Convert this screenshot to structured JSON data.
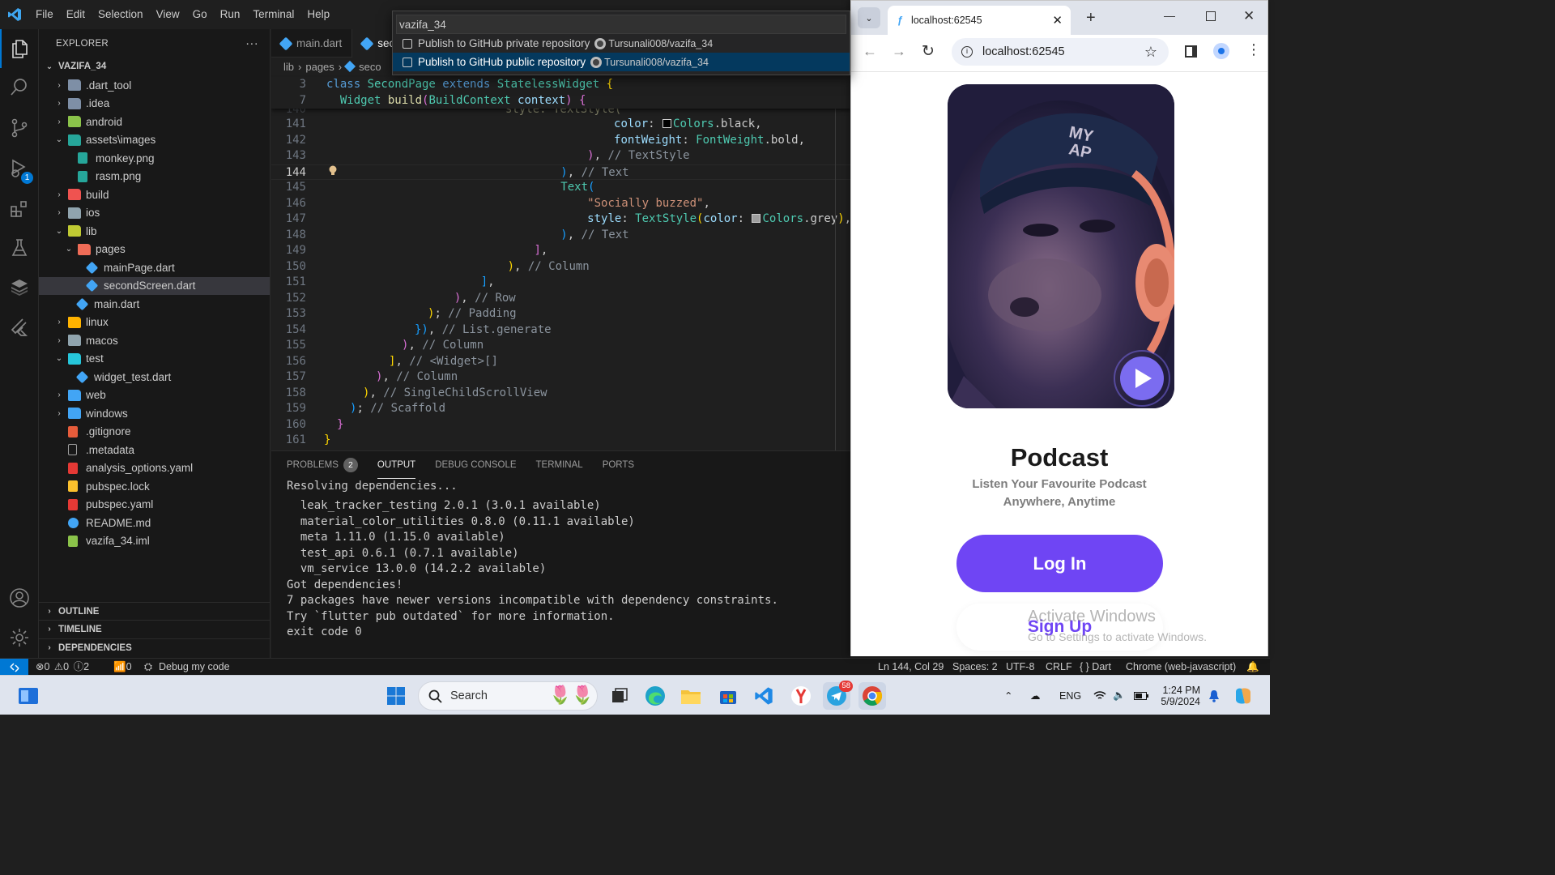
{
  "menu": [
    "File",
    "Edit",
    "Selection",
    "View",
    "Go",
    "Run",
    "Terminal",
    "Help"
  ],
  "palette": {
    "query": "vazifa_34",
    "items": [
      {
        "label": "Publish to GitHub private repository",
        "repo": "Tursunali008/vazifa_34",
        "selected": false
      },
      {
        "label": "Publish to GitHub public repository",
        "repo": "Tursunali008/vazifa_34",
        "selected": true
      }
    ]
  },
  "activity": {
    "icons": [
      "explorer-icon",
      "search-icon",
      "source-control-icon",
      "run-debug-icon",
      "extensions-icon",
      "testing-icon",
      "stack-icon",
      "flutter-icon",
      "account-icon",
      "settings-gear-icon"
    ],
    "debug_badge": "1"
  },
  "sidebar": {
    "title": "EXPLORER",
    "more": "···",
    "project": "VAZIFA_34",
    "tree": [
      {
        "label": ".dart_tool",
        "indent": 0,
        "chev": "›",
        "icon": "folder",
        "color": "#7e8fa6"
      },
      {
        "label": ".idea",
        "indent": 0,
        "chev": "›",
        "icon": "folder",
        "color": "#7e8fa6"
      },
      {
        "label": "android",
        "indent": 0,
        "chev": "›",
        "icon": "folder",
        "color": "#8bc34a"
      },
      {
        "label": "assets\\images",
        "indent": 0,
        "chev": "⌄",
        "icon": "folder",
        "color": "#26a69a"
      },
      {
        "label": "monkey.png",
        "indent": 1,
        "chev": "",
        "icon": "image",
        "color": "#26a69a"
      },
      {
        "label": "rasm.png",
        "indent": 1,
        "chev": "",
        "icon": "image",
        "color": "#26a69a"
      },
      {
        "label": "build",
        "indent": 0,
        "chev": "›",
        "icon": "folder",
        "color": "#ef5350"
      },
      {
        "label": "ios",
        "indent": 0,
        "chev": "›",
        "icon": "folder",
        "color": "#90a4ae"
      },
      {
        "label": "lib",
        "indent": 0,
        "chev": "⌄",
        "icon": "folder",
        "color": "#c0ca33"
      },
      {
        "label": "pages",
        "indent": 1,
        "chev": "⌄",
        "icon": "folder",
        "color": "#ef6c57"
      },
      {
        "label": "mainPage.dart",
        "indent": 2,
        "chev": "",
        "icon": "dart",
        "color": "#42a5f5"
      },
      {
        "label": "secondScreen.dart",
        "indent": 2,
        "chev": "",
        "icon": "dart",
        "color": "#42a5f5",
        "selected": true
      },
      {
        "label": "main.dart",
        "indent": 1,
        "chev": "",
        "icon": "dart",
        "color": "#42a5f5"
      },
      {
        "label": "linux",
        "indent": 0,
        "chev": "›",
        "icon": "folder",
        "color": "#ffb300"
      },
      {
        "label": "macos",
        "indent": 0,
        "chev": "›",
        "icon": "folder",
        "color": "#90a4ae"
      },
      {
        "label": "test",
        "indent": 0,
        "chev": "⌄",
        "icon": "folder",
        "color": "#26c6da"
      },
      {
        "label": "widget_test.dart",
        "indent": 1,
        "chev": "",
        "icon": "dart",
        "color": "#42a5f5"
      },
      {
        "label": "web",
        "indent": 0,
        "chev": "›",
        "icon": "folder",
        "color": "#42a5f5"
      },
      {
        "label": "windows",
        "indent": 0,
        "chev": "›",
        "icon": "folder",
        "color": "#42a5f5"
      },
      {
        "label": ".gitignore",
        "indent": 0,
        "chev": "",
        "icon": "git",
        "color": "#e65c3b"
      },
      {
        "label": ".metadata",
        "indent": 0,
        "chev": "",
        "icon": "file",
        "color": "#9e9e9e"
      },
      {
        "label": "analysis_options.yaml",
        "indent": 0,
        "chev": "",
        "icon": "yaml",
        "color": "#e53935"
      },
      {
        "label": "pubspec.lock",
        "indent": 0,
        "chev": "",
        "icon": "lock",
        "color": "#fbc02d"
      },
      {
        "label": "pubspec.yaml",
        "indent": 0,
        "chev": "",
        "icon": "yaml",
        "color": "#e53935"
      },
      {
        "label": "README.md",
        "indent": 0,
        "chev": "",
        "icon": "info",
        "color": "#42a5f5"
      },
      {
        "label": "vazifa_34.iml",
        "indent": 0,
        "chev": "",
        "icon": "iml",
        "color": "#8bc34a"
      }
    ],
    "sections": [
      "OUTLINE",
      "TIMELINE",
      "DEPENDENCIES"
    ]
  },
  "editor": {
    "tabs": [
      "main.dart",
      "seco"
    ],
    "breadcrumb": [
      "lib",
      "pages",
      "seco"
    ],
    "sticky": [
      {
        "n": "3",
        "tokens": [
          [
            "kw",
            "class "
          ],
          [
            "cls",
            "SecondPage "
          ],
          [
            "kw",
            "extends "
          ],
          [
            "cls",
            "StatelessWidget "
          ],
          [
            "b1",
            "{"
          ]
        ]
      },
      {
        "n": "7",
        "tokens": [
          [
            "",
            "  "
          ],
          [
            "cls",
            "Widget "
          ],
          [
            "fn",
            "build"
          ],
          [
            "b2",
            "("
          ],
          [
            "cls",
            "BuildContext "
          ],
          [
            "prm",
            "context"
          ],
          [
            "b2",
            ")"
          ],
          [
            "",
            " "
          ],
          [
            "b2",
            "{"
          ]
        ]
      }
    ],
    "lines": [
      {
        "n": "141",
        "tokens": [
          [
            "",
            "              "
          ],
          [
            "prm",
            "color"
          ],
          [
            "",
            ": "
          ],
          [
            "swatch",
            "#000000"
          ],
          [
            "cls",
            "Colors"
          ],
          [
            "",
            ".black,"
          ]
        ]
      },
      {
        "n": "142",
        "tokens": [
          [
            "",
            "              "
          ],
          [
            "prm",
            "fontWeight"
          ],
          [
            "",
            ": "
          ],
          [
            "cls",
            "FontWeight"
          ],
          [
            "",
            ".bold,"
          ]
        ]
      },
      {
        "n": "143",
        "tokens": [
          [
            "",
            "            "
          ],
          [
            "b2",
            ")"
          ],
          [
            "",
            ", "
          ],
          [
            "cmg",
            "// TextStyle"
          ]
        ]
      },
      {
        "n": "144",
        "tokens": [
          [
            "",
            "          "
          ],
          [
            "b3",
            ")"
          ],
          [
            "",
            ", "
          ],
          [
            "cmg",
            "// Text"
          ]
        ],
        "current": true
      },
      {
        "n": "145",
        "tokens": [
          [
            "",
            "          "
          ],
          [
            "cls",
            "Text"
          ],
          [
            "b3",
            "("
          ]
        ]
      },
      {
        "n": "146",
        "tokens": [
          [
            "",
            "            "
          ],
          [
            "str",
            "\"Socially buzzed\""
          ],
          [
            "",
            ","
          ]
        ]
      },
      {
        "n": "147",
        "tokens": [
          [
            "",
            "            "
          ],
          [
            "prm",
            "style"
          ],
          [
            "",
            ": "
          ],
          [
            "cls",
            "TextStyle"
          ],
          [
            "b1",
            "("
          ],
          [
            "prm",
            "color"
          ],
          [
            "",
            ": "
          ],
          [
            "swatch",
            "#9e9e9e"
          ],
          [
            "cls",
            "Colors"
          ],
          [
            "",
            ".grey"
          ],
          [
            "b1",
            ")"
          ],
          [
            "",
            ","
          ]
        ]
      },
      {
        "n": "148",
        "tokens": [
          [
            "",
            "          "
          ],
          [
            "b3",
            ")"
          ],
          [
            "",
            ", "
          ],
          [
            "cmg",
            "// Text"
          ]
        ]
      },
      {
        "n": "149",
        "tokens": [
          [
            "",
            "        "
          ],
          [
            "b2",
            "]"
          ],
          [
            "",
            ","
          ]
        ]
      },
      {
        "n": "150",
        "tokens": [
          [
            "",
            "      "
          ],
          [
            "b1",
            ")"
          ],
          [
            "",
            ", "
          ],
          [
            "cmg",
            "// Column"
          ]
        ]
      },
      {
        "n": "151",
        "tokens": [
          [
            "",
            "    "
          ],
          [
            "b3",
            "]"
          ],
          [
            "",
            ","
          ]
        ]
      },
      {
        "n": "152",
        "tokens": [
          [
            "",
            "  "
          ],
          [
            "b2",
            ")"
          ],
          [
            "",
            ", "
          ],
          [
            "cmg",
            "// Row"
          ]
        ]
      },
      {
        "n": "153",
        "tokens": [
          [
            "",
            ""
          ],
          [
            "b1",
            ")"
          ],
          [
            "",
            "; "
          ],
          [
            "cmg",
            "// Padding"
          ]
        ]
      },
      {
        "n": "154",
        "tokens": [
          [
            "",
            ""
          ],
          [
            "b3",
            "})"
          ],
          [
            "",
            ", "
          ],
          [
            "cmg",
            "// List.generate"
          ]
        ]
      },
      {
        "n": "155",
        "tokens": [
          [
            "",
            ""
          ],
          [
            "b2",
            ")"
          ],
          [
            "",
            ", "
          ],
          [
            "cmg",
            "// Column"
          ]
        ]
      },
      {
        "n": "156",
        "tokens": [
          [
            "",
            ""
          ],
          [
            "b1",
            "]"
          ],
          [
            "",
            ", "
          ],
          [
            "cmg",
            "// <Widget>[]"
          ]
        ]
      },
      {
        "n": "157",
        "tokens": [
          [
            "",
            ""
          ],
          [
            "b2",
            ")"
          ],
          [
            "",
            ", "
          ],
          [
            "cmg",
            "// Column"
          ]
        ]
      },
      {
        "n": "158",
        "tokens": [
          [
            "",
            ""
          ],
          [
            "b1",
            ")"
          ],
          [
            "",
            ", "
          ],
          [
            "cmg",
            "// SingleChildScrollView"
          ]
        ]
      },
      {
        "n": "159",
        "tokens": [
          [
            "",
            ""
          ],
          [
            "b3",
            ")"
          ],
          [
            "",
            "; "
          ],
          [
            "cmg",
            "// Scaffold"
          ]
        ]
      },
      {
        "n": "160",
        "tokens": [
          [
            "",
            ""
          ],
          [
            "b2",
            "}"
          ]
        ]
      },
      {
        "n": "161",
        "tokens": [
          [
            "",
            ""
          ],
          [
            "b1",
            "}"
          ]
        ]
      }
    ],
    "peek_line": {
      "n": "140",
      "text": "style: TextStyle("
    }
  },
  "panel": {
    "tabs": [
      {
        "label": "PROBLEMS",
        "badge": "2"
      },
      {
        "label": "OUTPUT",
        "active": true
      },
      {
        "label": "DEBUG CONSOLE"
      },
      {
        "label": "TERMINAL"
      },
      {
        "label": "PORTS"
      }
    ],
    "sticky_line": "Resolving dependencies...",
    "lines": [
      "  leak_tracker_testing 2.0.1 (3.0.1 available)",
      "  material_color_utilities 0.8.0 (0.11.1 available)",
      "  meta 1.11.0 (1.15.0 available)",
      "  test_api 0.6.1 (0.7.1 available)",
      "  vm_service 13.0.0 (14.2.2 available)",
      "Got dependencies!",
      "7 packages have newer versions incompatible with dependency constraints.",
      "Try `flutter pub outdated` for more information.",
      "exit code 0"
    ]
  },
  "status": {
    "errors": "0",
    "warnings": "0",
    "infos": "2",
    "ports": "0",
    "debug": "Debug my code",
    "position": "Ln 144, Col 29",
    "spaces": "Spaces: 2",
    "encoding": "UTF-8",
    "eol": "CRLF",
    "language": "Dart",
    "device": "Chrome (web-javascript)"
  },
  "browser": {
    "tab_title": "localhost:62545",
    "url": "localhost:62545",
    "page": {
      "title": "Podcast",
      "subtitle_line1": "Listen Your Favourite Podcast",
      "subtitle_line2": "Anywhere, Anytime",
      "login": "Log In",
      "signup": "Sign Up",
      "hero_cap": "MY\nAP"
    },
    "watermark_title": "Activate Windows",
    "watermark_sub": "Go to Settings to activate Windows."
  },
  "taskbar": {
    "search": "Search",
    "telegram_badge": "58",
    "lang": "ENG",
    "time": "1:24 PM",
    "date": "5/9/2024"
  }
}
